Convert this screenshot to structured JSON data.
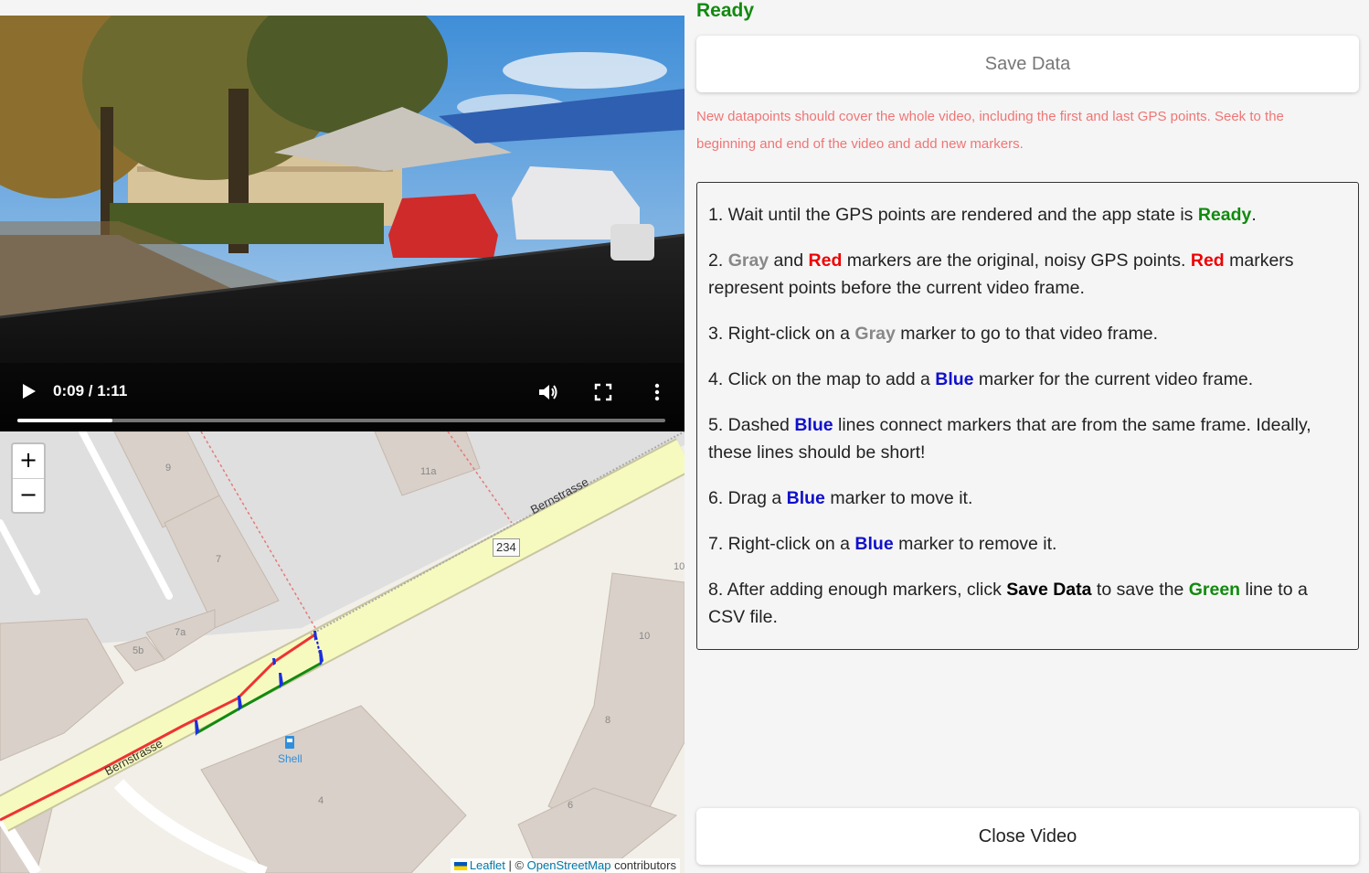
{
  "video": {
    "time_display": "0:09 / 1:11",
    "progress_fraction": 0.146,
    "icons": [
      "play-icon",
      "volume-icon",
      "fullscreen-icon",
      "more-vertical-icon"
    ]
  },
  "map": {
    "zoom_in": "+",
    "zoom_out": "−",
    "road_name_top": "Bernstrasse",
    "road_name_bottom": "Bernstrasse",
    "road_ref": "234",
    "poi": "Shell",
    "house_numbers": [
      "9",
      "11a",
      "7",
      "7a",
      "5b",
      "10",
      "8",
      "6",
      "4",
      "10"
    ],
    "attribution": {
      "leaflet": "Leaflet",
      "separator": " | © ",
      "osm": "OpenStreetMap",
      "suffix": " contributors"
    }
  },
  "panel": {
    "status": "Ready",
    "save_button": "Save Data",
    "warning": "New datapoints should cover the whole video, including the first and last GPS points. Seek to the beginning and end of the video and add new markers.",
    "close_button": "Close Video",
    "instructions": {
      "s1": {
        "a": "1. Wait until the GPS points are rendered and the app state is ",
        "b": "Ready",
        "c": "."
      },
      "s2": {
        "a": "2. ",
        "b": "Gray",
        "c": " and ",
        "d": "Red",
        "e": " markers are the original, noisy GPS points. ",
        "f": "Red",
        "g": " markers represent points before the current video frame."
      },
      "s3": {
        "a": "3. Right-click on a ",
        "b": "Gray",
        "c": " marker to go to that video frame."
      },
      "s4": {
        "a": "4. Click on the map to add a ",
        "b": "Blue",
        "c": " marker for the current video frame."
      },
      "s5": {
        "a": "5. Dashed ",
        "b": "Blue",
        "c": " lines connect markers that are from the same frame. Ideally, these lines should be short!"
      },
      "s6": {
        "a": "6. Drag a ",
        "b": "Blue",
        "c": " marker to move it."
      },
      "s7": {
        "a": "7. Right-click on a ",
        "b": "Blue",
        "c": " marker to remove it."
      },
      "s8": {
        "a": "8. After adding enough markers, click ",
        "b": "Save Data",
        "c": " to save the ",
        "d": "Green",
        "e": " line to a CSV file."
      }
    }
  },
  "colors": {
    "ready": "#118a0f",
    "warning": "#f07575",
    "blue": "#1010cc",
    "red": "#e00000",
    "gray": "#888888",
    "road": "#f7fabf",
    "building": "#d9d0c9"
  }
}
